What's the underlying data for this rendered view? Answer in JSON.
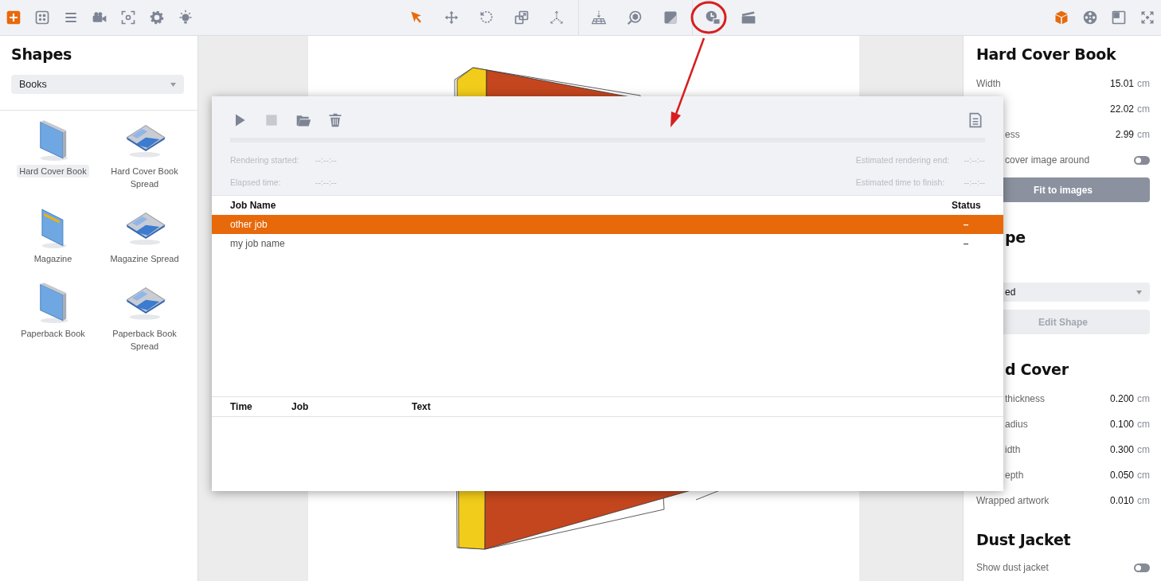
{
  "toolbar": {
    "groups": [
      {
        "items": [
          {
            "selected": true
          },
          {
            "selected": false
          },
          {
            "selected": false
          },
          {
            "selected": false
          },
          {
            "selected": false
          },
          {
            "selected": false
          },
          {
            "selected": false
          }
        ]
      },
      {
        "items": [
          {
            "selected": true
          },
          {
            "selected": false
          },
          {
            "selected": false
          },
          {
            "selected": false
          },
          {
            "selected": false
          }
        ]
      },
      {
        "items": [
          {
            "selected": false
          },
          {
            "selected": false
          },
          {
            "selected": false
          }
        ]
      },
      {
        "items": [
          {
            "selected": false
          },
          {
            "selected": false
          }
        ]
      },
      {
        "items": [
          {
            "selected": true
          },
          {
            "selected": false
          },
          {
            "selected": false
          },
          {
            "selected": false
          }
        ]
      }
    ]
  },
  "sidebar": {
    "title": "Shapes",
    "category": "Books",
    "items": [
      {
        "kind": "book",
        "label": "Hard Cover Book",
        "selected": true
      },
      {
        "kind": "spread",
        "label": "Hard Cover Book Spread",
        "selected": false
      },
      {
        "kind": "magazine",
        "label": "Magazine",
        "selected": false
      },
      {
        "kind": "spread",
        "label": "Magazine Spread",
        "selected": false
      },
      {
        "kind": "book",
        "label": "Paperback Book",
        "selected": false
      },
      {
        "kind": "spread",
        "label": "Paperback Book Spread",
        "selected": false
      }
    ]
  },
  "properties": {
    "sections": [
      {
        "heading": "Hard Cover Book",
        "partial": false,
        "items": [
          {
            "kind": "value",
            "label": "Width",
            "partial": false,
            "value": "15.01",
            "unit": "cm"
          },
          {
            "kind": "value",
            "value": "22.02",
            "unit": "cm"
          },
          {
            "kind": "value",
            "label": "ess",
            "partial": true,
            "value": "2.99",
            "unit": "cm"
          },
          {
            "kind": "toggle",
            "label": "cover image around",
            "partial": true,
            "on": false
          },
          {
            "kind": "button",
            "label": "Fit to images",
            "disabled": false
          }
        ]
      },
      {
        "heading": "pe",
        "partial": true,
        "items": [
          {
            "kind": "select",
            "value": "ed",
            "partial": true
          },
          {
            "kind": "button",
            "label": "Edit Shape",
            "disabled": true
          }
        ]
      },
      {
        "heading": "d Cover",
        "partial": true,
        "items": [
          {
            "kind": "value",
            "label": "thickness",
            "partial": true,
            "value": "0.200",
            "unit": "cm"
          },
          {
            "kind": "value",
            "label": "adius",
            "partial": true,
            "value": "0.100",
            "unit": "cm"
          },
          {
            "kind": "value",
            "label": "idth",
            "partial": true,
            "value": "0.300",
            "unit": "cm"
          },
          {
            "kind": "value",
            "label": "epth",
            "partial": true,
            "value": "0.050",
            "unit": "cm"
          },
          {
            "kind": "value",
            "label": "Wrapped artwork",
            "partial": false,
            "value": "0.010",
            "unit": "cm"
          }
        ]
      },
      {
        "heading": "Dust Jacket",
        "partial": false,
        "items": [
          {
            "kind": "toggle",
            "label": "Show dust jacket",
            "partial": false,
            "on": false
          }
        ]
      }
    ]
  },
  "render_queue": {
    "toolbar": [
      {
        "disabled": false
      },
      {
        "disabled": true
      },
      {
        "disabled": false
      },
      {
        "disabled": false
      }
    ],
    "progress": {
      "level": 0
    },
    "info_left": [
      {
        "label": "Rendering started:",
        "value": "--:--:--"
      },
      {
        "label": "Elapsed time:",
        "value": "--:--:--"
      }
    ],
    "info_right": [
      {
        "label": "Estimated rendering end:",
        "value": "--:--:--"
      },
      {
        "label": "Estimated time to finish:",
        "value": "--:--:--"
      }
    ],
    "jobs": {
      "columns": [
        "Job Name",
        "Status"
      ],
      "rows": [
        {
          "name": "other job",
          "status": "–",
          "selected": true
        },
        {
          "name": "my job name",
          "status": "–",
          "selected": false
        }
      ]
    },
    "log": {
      "columns": [
        "Time",
        "Job",
        "Text"
      ]
    }
  }
}
